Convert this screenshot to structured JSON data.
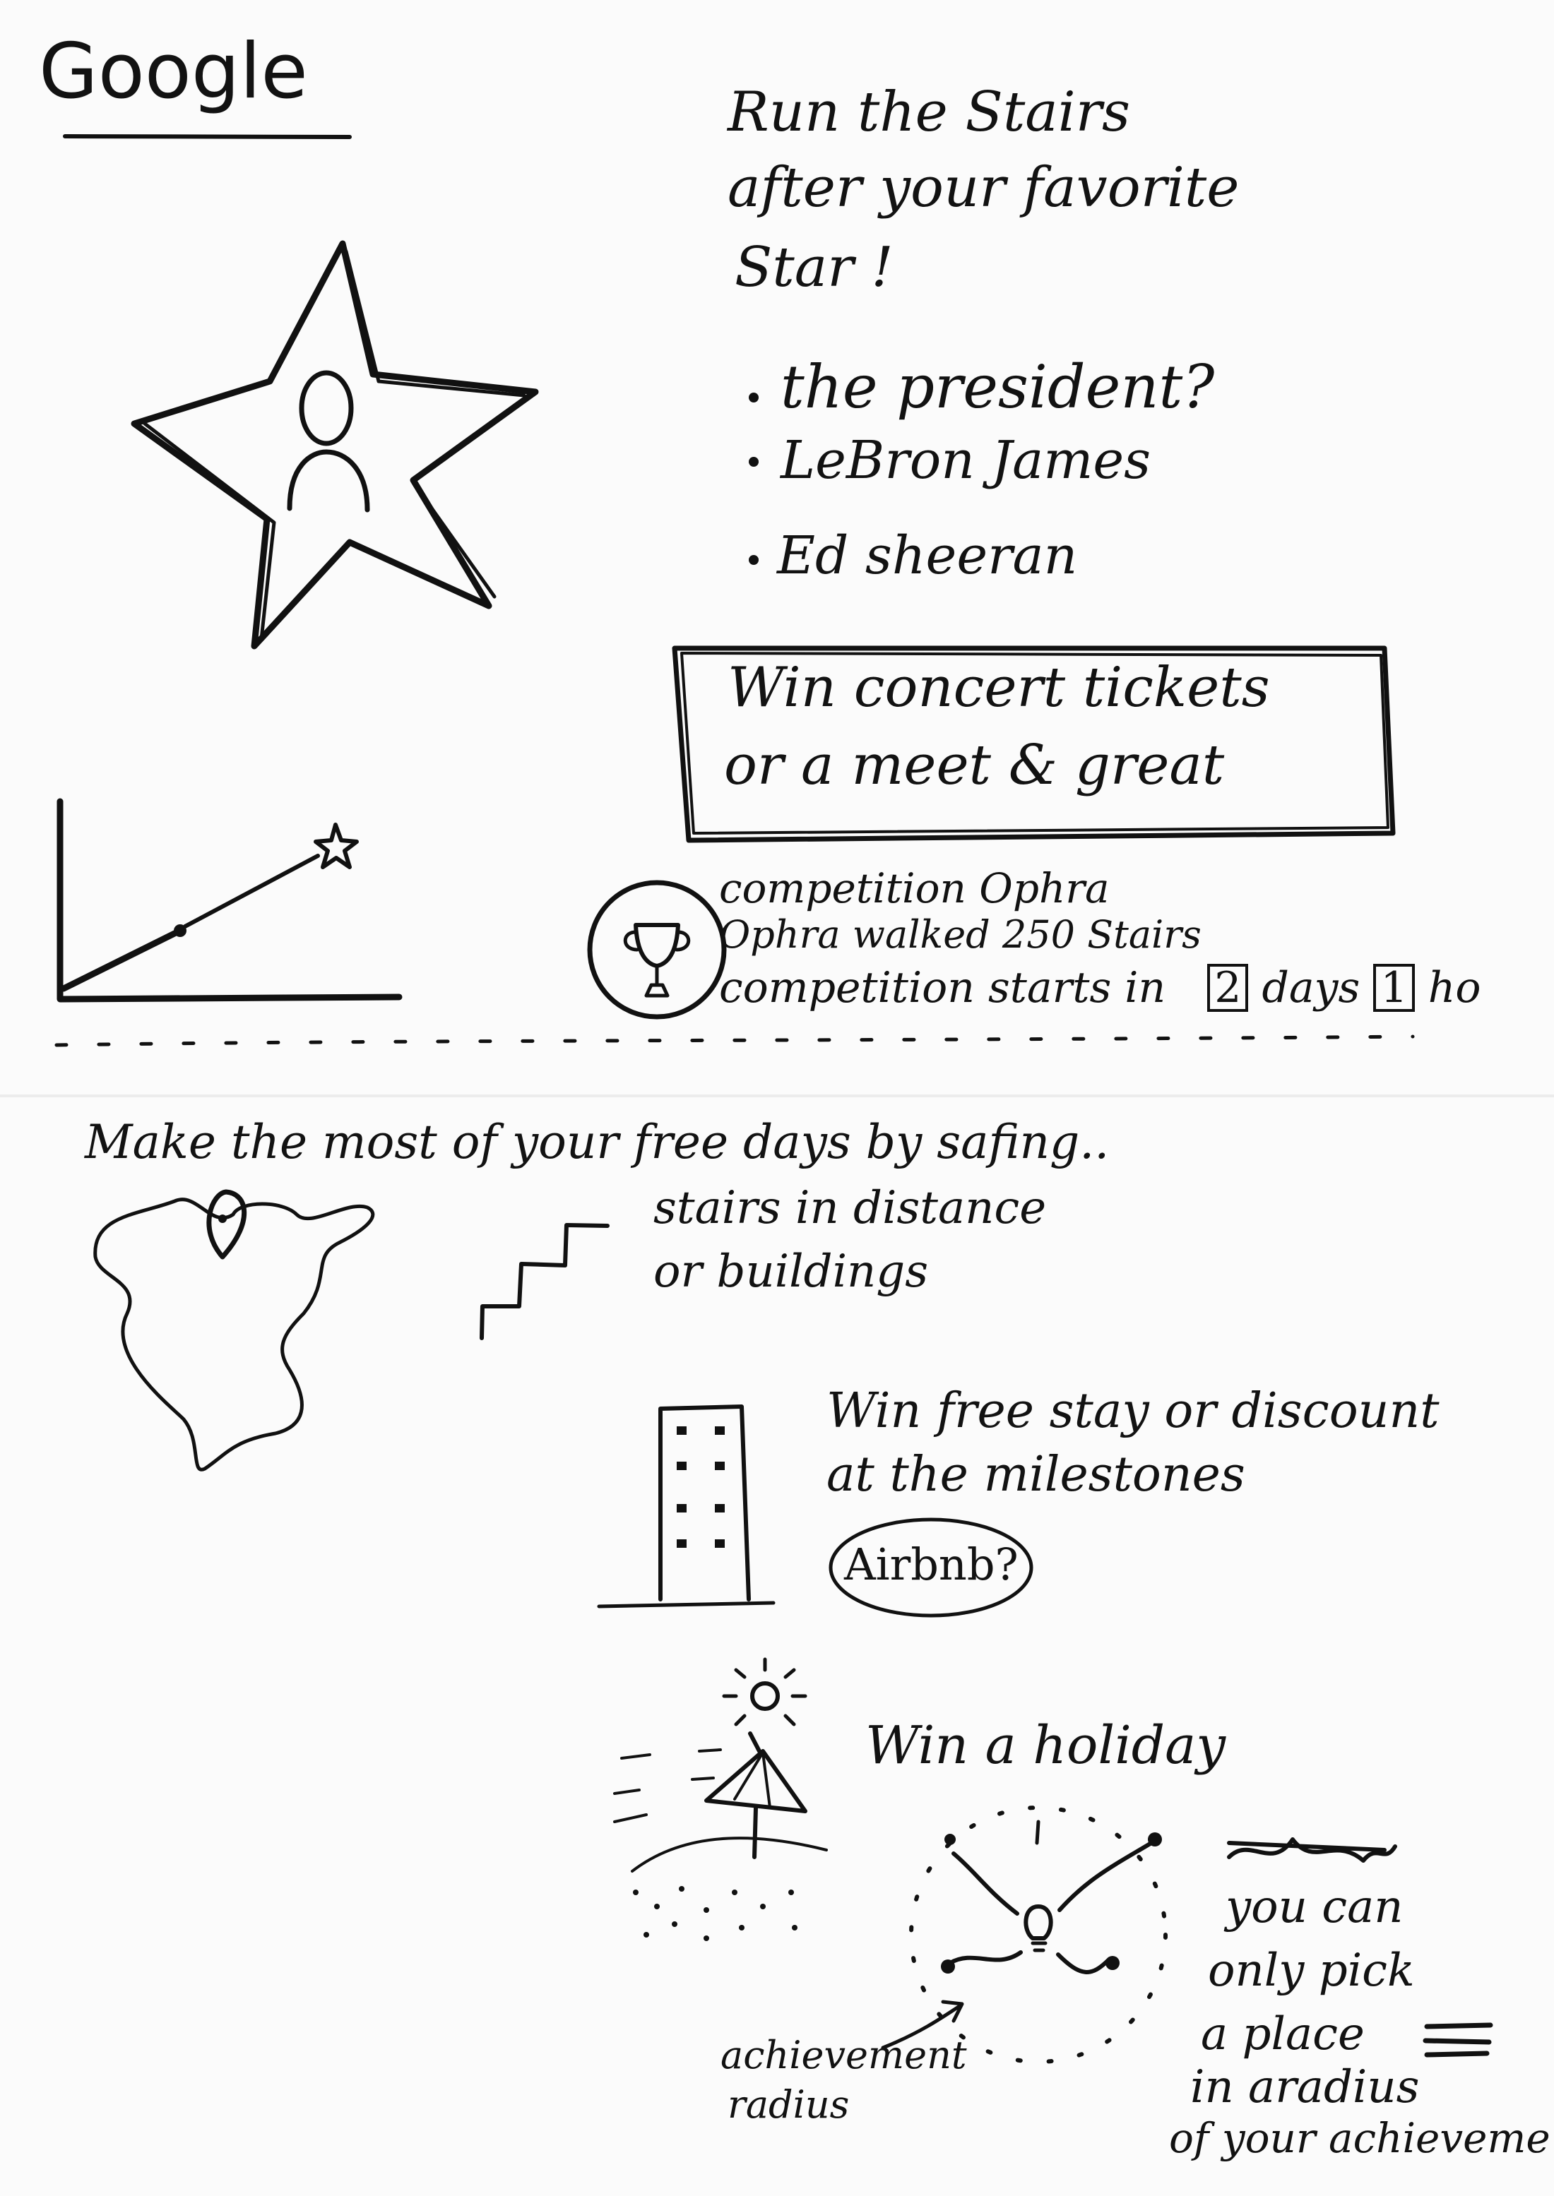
{
  "page": {
    "brand": "Google",
    "headline": [
      "Run the Stairs",
      "after your favorite",
      "Star !"
    ],
    "celebrities": [
      "the president?",
      "LeBron James",
      "Ed sheeran"
    ],
    "prize_box": [
      "Win concert tickets",
      "or a meet & great"
    ],
    "competition": {
      "title": "competition Ophra",
      "progress": "Ophra walked 250 Stairs",
      "countdown_prefix": "competition starts in",
      "days_value": "2",
      "days_label": "days",
      "hours_value": "1",
      "hours_label": "ho"
    },
    "section2": {
      "title": "Make the most of your free days by safing..",
      "stairs_text": [
        "stairs in distance",
        "or buildings"
      ],
      "stay_text": [
        "Win free stay or discount",
        "at the milestones"
      ],
      "airbnb": "Airbnb?",
      "holiday": "Win a holiday",
      "pick_text": [
        "you can",
        "only pick",
        "a place",
        "in aradius",
        "of your achieveme"
      ],
      "achievement_label": [
        "achievement",
        "radius"
      ]
    }
  }
}
